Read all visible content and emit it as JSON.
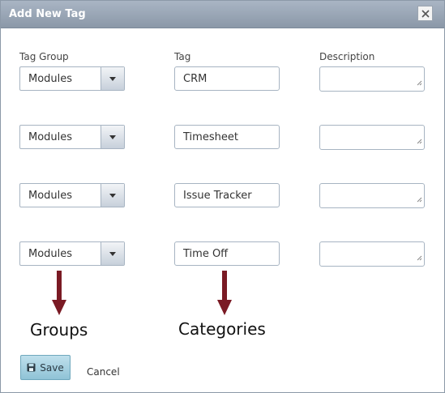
{
  "dialog": {
    "title": "Add New Tag",
    "close_icon": "close-icon"
  },
  "columns": {
    "group": "Tag Group",
    "tag": "Tag",
    "description": "Description"
  },
  "rows": [
    {
      "group": "Modules",
      "tag": "CRM",
      "description": ""
    },
    {
      "group": "Modules",
      "tag": "Timesheet",
      "description": ""
    },
    {
      "group": "Modules",
      "tag": "Issue Tracker",
      "description": ""
    },
    {
      "group": "Modules",
      "tag": "Time Off",
      "description": ""
    }
  ],
  "annotations": {
    "groups": "Groups",
    "categories": "Categories",
    "arrow_color": "#7a1a24"
  },
  "footer": {
    "save_label": "Save",
    "save_icon": "floppy-disk-icon",
    "cancel_label": "Cancel"
  },
  "colors": {
    "titlebar": "#95a2b2",
    "border": "#a7b4c2",
    "save_button": "#a6d1e1"
  }
}
